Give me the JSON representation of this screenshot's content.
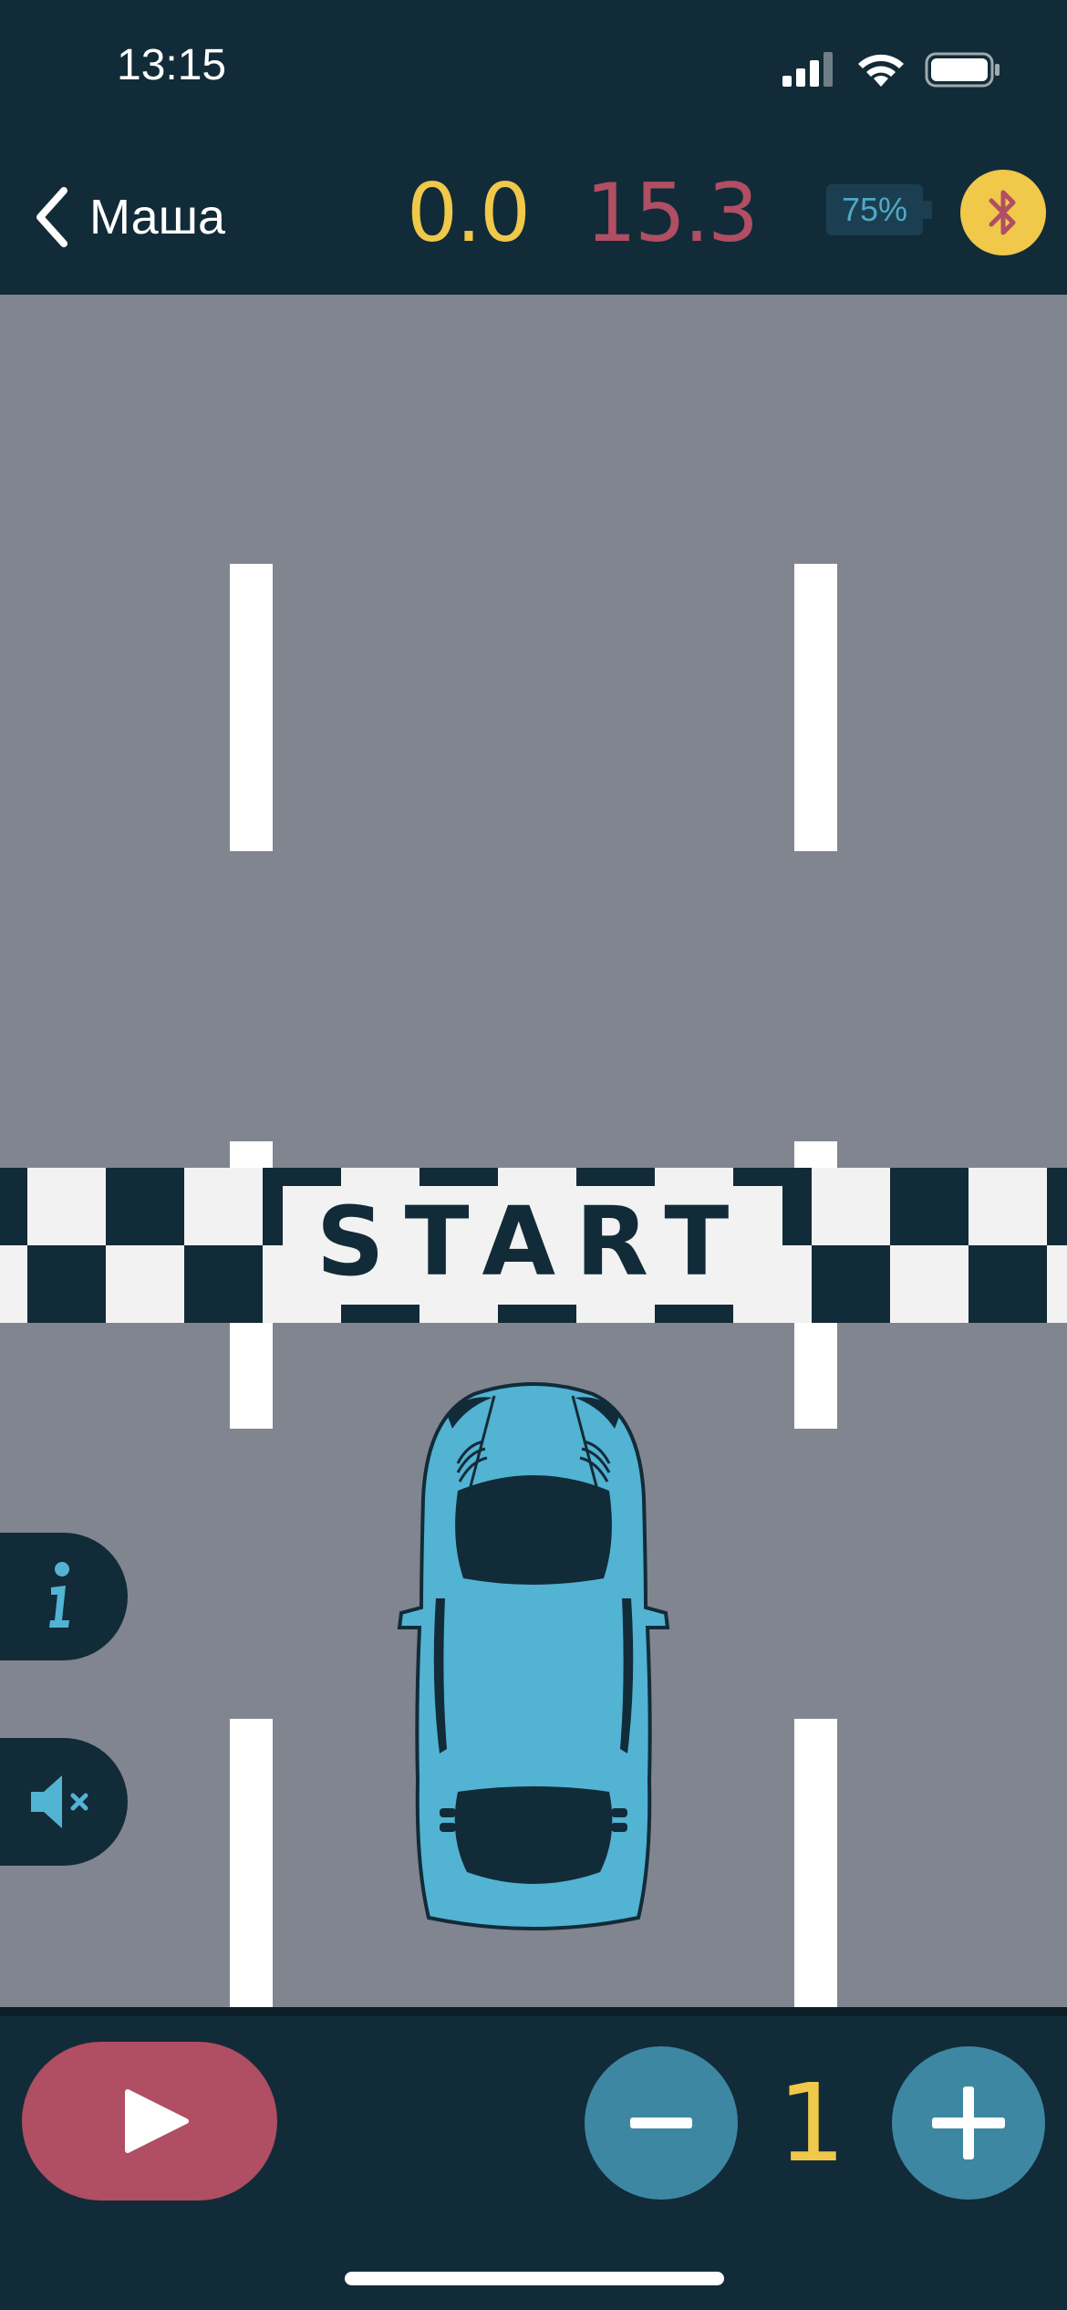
{
  "status_bar": {
    "time": "13:15",
    "icons": [
      "cellular-signal-icon",
      "wifi-icon",
      "battery-icon"
    ]
  },
  "header": {
    "back_label": "Маша",
    "score_current": "0.0",
    "score_best": "15.3",
    "battery_level": "75%",
    "bluetooth_icon": "bluetooth-icon"
  },
  "track": {
    "start_label": "START",
    "car_icon": "race-car-icon"
  },
  "side_controls": {
    "info_icon": "info-icon",
    "mute_icon": "speaker-muted-icon"
  },
  "bottom_bar": {
    "play_icon": "play-icon",
    "minus_icon": "minus-icon",
    "plus_icon": "plus-icon",
    "count": "1"
  },
  "colors": {
    "background": "#122b38",
    "road": "#818590",
    "accent_yellow": "#f0c84a",
    "accent_red": "#b04e63",
    "accent_blue": "#3e87a3",
    "car_blue": "#52b3d3"
  }
}
